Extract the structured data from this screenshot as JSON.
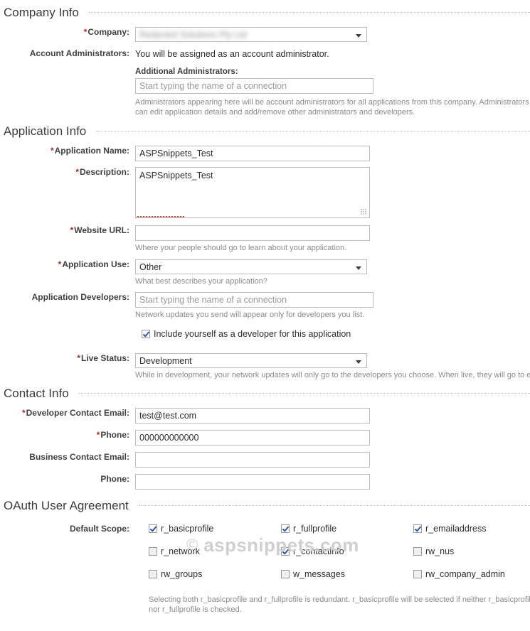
{
  "sections": {
    "company": {
      "title": "Company Info"
    },
    "application": {
      "title": "Application Info"
    },
    "contact": {
      "title": "Contact Info"
    },
    "oauth": {
      "title": "OAuth User Agreement"
    }
  },
  "company": {
    "company_label": "Company:",
    "company_value": "Redacted Solutions Pty Ltd",
    "admins_label": "Account Administrators:",
    "admins_text": "You will be assigned as an account administrator.",
    "additional_admins_label": "Additional Administrators:",
    "additional_admins_placeholder": "Start typing the name of a connection",
    "additional_admins_value": "",
    "admins_hint": "Administrators appearing here will be account administrators for all applications from this company. Administrators can edit application details and add/remove other administrators and developers."
  },
  "application": {
    "name_label": "Application Name:",
    "name_value": "ASPSnippets_Test",
    "description_label": "Description:",
    "description_value": "ASPSnippets_Test",
    "website_label": "Website URL:",
    "website_value": "",
    "website_hint": "Where your people should go to learn about your application.",
    "use_label": "Application Use:",
    "use_value": "Other",
    "use_hint": "What best describes your application?",
    "developers_label": "Application Developers:",
    "developers_placeholder": "Start typing the name of a connection",
    "developers_value": "",
    "developers_hint": "Network updates you send will appear only for developers you list.",
    "include_self_label": "Include yourself as a developer for this application",
    "include_self_checked": true,
    "live_status_label": "Live Status:",
    "live_status_value": "Development",
    "live_status_hint": "While in development, your network updates will only go to the developers you choose. When live, they will go to everyone."
  },
  "contact": {
    "dev_email_label": "Developer Contact Email:",
    "dev_email_value": "test@test.com",
    "dev_phone_label": "Phone:",
    "dev_phone_value": "000000000000",
    "biz_email_label": "Business Contact Email:",
    "biz_email_value": "",
    "biz_phone_label": "Phone:",
    "biz_phone_value": ""
  },
  "oauth": {
    "default_scope_label": "Default Scope:",
    "scopes": [
      {
        "name": "r_basicprofile",
        "checked": true
      },
      {
        "name": "r_fullprofile",
        "checked": true
      },
      {
        "name": "r_emailaddress",
        "checked": true
      },
      {
        "name": "r_network",
        "checked": false
      },
      {
        "name": "r_contactinfo",
        "checked": true
      },
      {
        "name": "rw_nus",
        "checked": false
      },
      {
        "name": "rw_groups",
        "checked": false
      },
      {
        "name": "w_messages",
        "checked": false
      },
      {
        "name": "rw_company_admin",
        "checked": false
      }
    ],
    "scope_hint": "Selecting both r_basicprofile and r_fullprofile is redundant. r_basicprofile will be selected if neither r_basicprofile nor r_fullprofile is checked."
  },
  "watermark": {
    "mark": "©",
    "text": "aspsnippets.com"
  },
  "colors": {
    "required_asterisk": "#9e2b25",
    "border": "#bcbcbc",
    "hint_text": "#8b8b8b",
    "watermark": "#cfcfcf",
    "checkmark": "#2b58b0"
  }
}
